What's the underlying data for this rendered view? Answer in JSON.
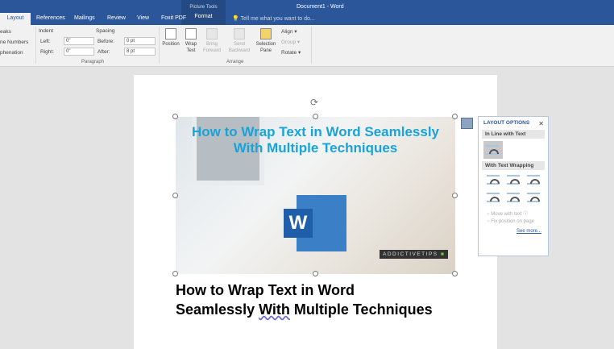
{
  "window": {
    "title": "Document1 - Word",
    "context_group": "Picture Tools",
    "context_tab": "Format"
  },
  "tabs": [
    "Layout",
    "References",
    "Mailings",
    "Review",
    "View",
    "Foxit PDF"
  ],
  "tell_me": "Tell me what you want to do...",
  "ribbon": {
    "page_setup": {
      "items": [
        "eaks",
        "ne Numbers",
        "phenation"
      ]
    },
    "paragraph": {
      "indent_label": "Indent",
      "left_label": "Left:",
      "left_value": "0\"",
      "right_label": "Right:",
      "right_value": "0\"",
      "spacing_label": "Spacing",
      "before_label": "Before:",
      "before_value": "0 pt",
      "after_label": "After:",
      "after_value": "8 pt",
      "group": "Paragraph"
    },
    "arrange": {
      "position": "Position",
      "wrap_text": "Wrap Text",
      "bring_forward": "Bring Forward",
      "send_backward": "Send Backward",
      "selection_pane": "Selection Pane",
      "align": "Align",
      "group_btn": "Group",
      "rotate": "Rotate",
      "group": "Arrange"
    }
  },
  "picture": {
    "title": "How to Wrap Text in Word Seamlessly With Multiple Techniques",
    "logo_letter": "W",
    "brand": "ADDICTIVETIPS"
  },
  "document": {
    "heading_line1": "How to Wrap Text in Word",
    "heading_line2a": "Seamlessly ",
    "heading_line2b": "With",
    "heading_line2c": " Multiple Techniques"
  },
  "layout_options": {
    "title": "LAYOUT OPTIONS",
    "close": "✕",
    "inline_header": "In Line with Text",
    "wrap_header": "With Text Wrapping",
    "move_with_text": "Move with text",
    "fix_position": "Fix position on page",
    "see_more": "See more..."
  }
}
